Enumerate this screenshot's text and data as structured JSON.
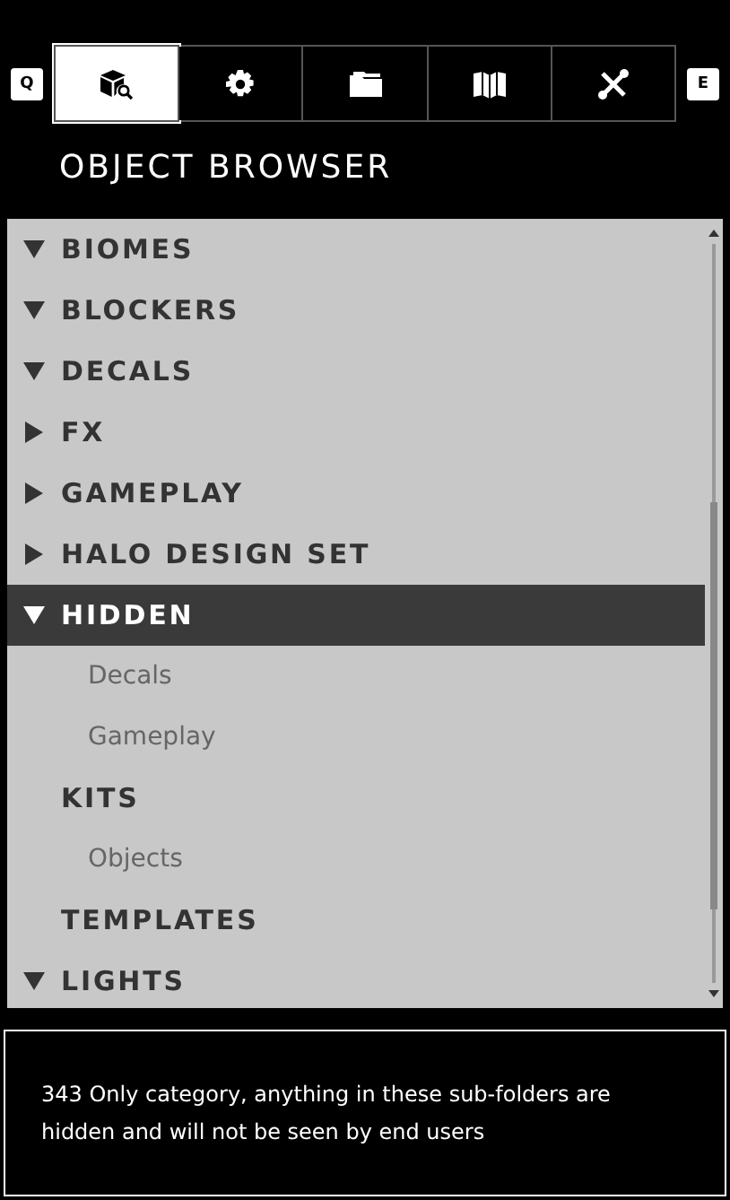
{
  "keys": {
    "left": "Q",
    "right": "E"
  },
  "tabs": [
    {
      "selected": true
    },
    {
      "selected": false
    },
    {
      "selected": false
    },
    {
      "selected": false
    },
    {
      "selected": false
    }
  ],
  "title": "OBJECT BROWSER",
  "tree": [
    {
      "label": "BIOMES",
      "kind": "category",
      "expanded": true,
      "selected": false
    },
    {
      "label": "BLOCKERS",
      "kind": "category",
      "expanded": true,
      "selected": false
    },
    {
      "label": "DECALS",
      "kind": "category",
      "expanded": true,
      "selected": false
    },
    {
      "label": "FX",
      "kind": "category",
      "expanded": false,
      "selected": false
    },
    {
      "label": "GAMEPLAY",
      "kind": "category",
      "expanded": false,
      "selected": false
    },
    {
      "label": "HALO DESIGN SET",
      "kind": "category",
      "expanded": false,
      "selected": false
    },
    {
      "label": "HIDDEN",
      "kind": "category",
      "expanded": true,
      "selected": true,
      "children": [
        {
          "label": "Decals",
          "kind": "entry",
          "selected": false
        },
        {
          "label": "Gameplay",
          "kind": "entry",
          "selected": false
        },
        {
          "label": "KITS",
          "kind": "category",
          "selected": false,
          "children": [
            {
              "label": "Objects",
              "kind": "entry",
              "selected": false
            }
          ]
        },
        {
          "label": "TEMPLATES",
          "kind": "category",
          "selected": false
        }
      ]
    },
    {
      "label": "LIGHTS",
      "kind": "category",
      "expanded": true,
      "selected": false
    }
  ],
  "description": "343 Only category, anything in these sub-folders are hidden and will not be seen by end users"
}
